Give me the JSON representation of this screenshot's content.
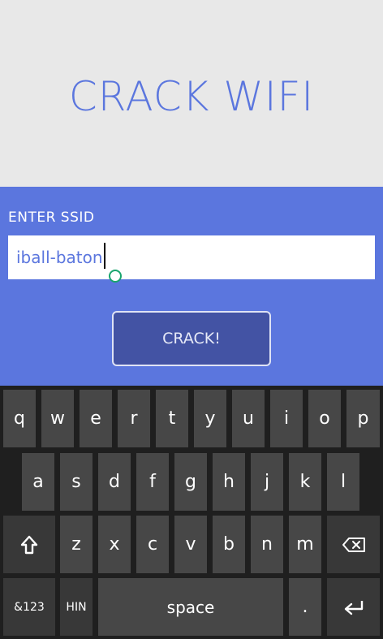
{
  "app": {
    "title": "CRACK WIFI"
  },
  "form": {
    "ssid_label": "ENTER SSID",
    "ssid_value": "iball-baton",
    "crack_label": "CRACK!"
  },
  "keyboard": {
    "row1": [
      "q",
      "w",
      "e",
      "r",
      "t",
      "y",
      "u",
      "i",
      "o",
      "p"
    ],
    "row2": [
      "a",
      "s",
      "d",
      "f",
      "g",
      "h",
      "j",
      "k",
      "l"
    ],
    "row3": [
      "z",
      "x",
      "c",
      "v",
      "b",
      "n",
      "m"
    ],
    "symbols_label": "&123",
    "language_label": "HIN",
    "space_label": "space",
    "period_label": ".",
    "icons": {
      "shift": "shift-icon",
      "backspace": "backspace-icon",
      "enter": "enter-icon"
    }
  },
  "colors": {
    "accent": "#5b76de",
    "button": "#4353a4",
    "header_bg": "#e8e8e8",
    "key": "#474747",
    "keyboard_bg": "#1f1f1f",
    "handle": "#1aa56e"
  }
}
